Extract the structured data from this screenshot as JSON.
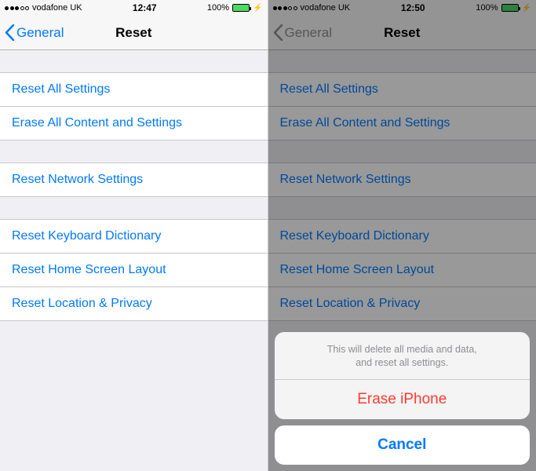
{
  "left": {
    "status": {
      "carrier": "vodafone UK",
      "time": "12:47",
      "battery": "100%"
    },
    "nav": {
      "back": "General",
      "title": "Reset"
    },
    "groups": [
      [
        "Reset All Settings",
        "Erase All Content and Settings"
      ],
      [
        "Reset Network Settings"
      ],
      [
        "Reset Keyboard Dictionary",
        "Reset Home Screen Layout",
        "Reset Location & Privacy"
      ]
    ]
  },
  "right": {
    "status": {
      "carrier": "vodafone UK",
      "time": "12:50",
      "battery": "100%"
    },
    "nav": {
      "back": "General",
      "title": "Reset"
    },
    "groups": [
      [
        "Reset All Settings",
        "Erase All Content and Settings"
      ],
      [
        "Reset Network Settings"
      ],
      [
        "Reset Keyboard Dictionary",
        "Reset Home Screen Layout",
        "Reset Location & Privacy"
      ]
    ],
    "sheet": {
      "message_line1": "This will delete all media and data,",
      "message_line2": "and reset all settings.",
      "action": "Erase iPhone",
      "cancel": "Cancel"
    }
  },
  "colors": {
    "link": "#007aff",
    "destructive": "#ff3b30",
    "bg": "#efeff4"
  }
}
